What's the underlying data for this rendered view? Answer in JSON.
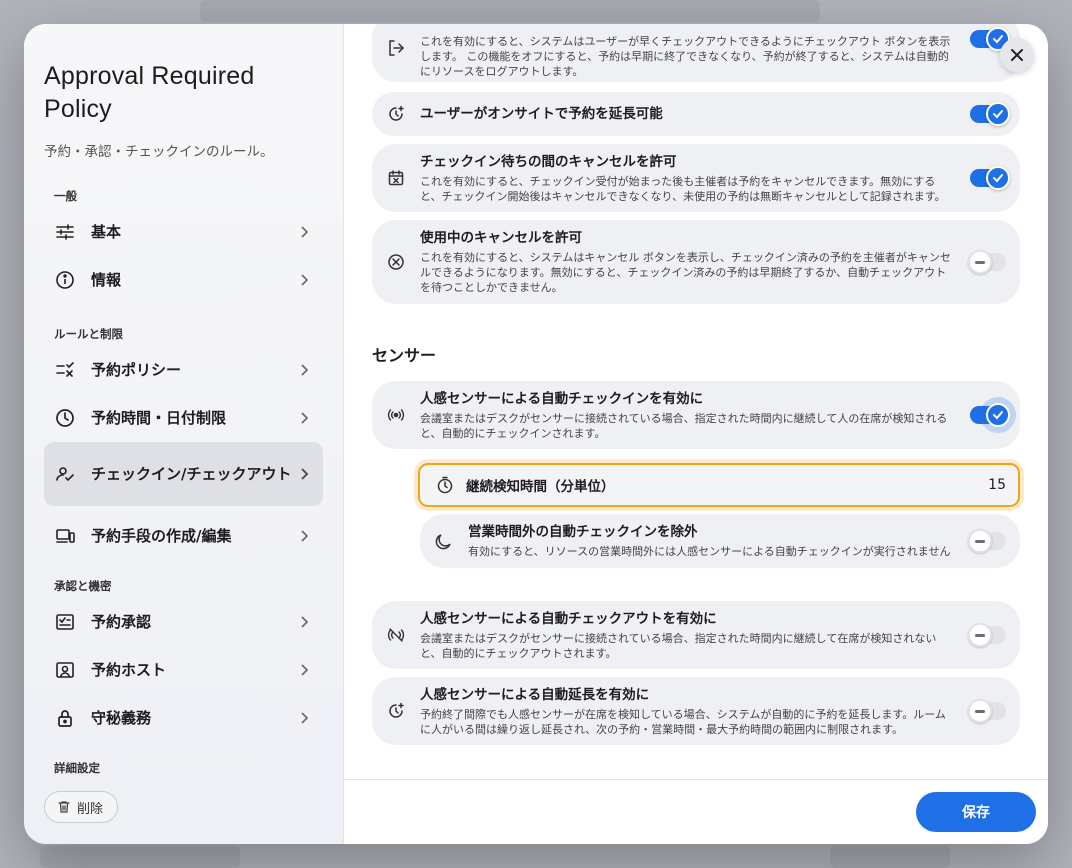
{
  "sidebar": {
    "title": "Approval Required Policy",
    "subtitle": "予約・承認・チェックインのルール。",
    "groups": [
      {
        "label": "一般"
      },
      {
        "label": "ルールと制限"
      },
      {
        "label": "承認と機密"
      },
      {
        "label": "詳細設定"
      }
    ],
    "items": [
      {
        "label": "基本",
        "icon": "sliders-icon"
      },
      {
        "label": "情報",
        "icon": "info-icon"
      },
      {
        "label": "予約ポリシー",
        "icon": "checklist-icon"
      },
      {
        "label": "予約時間・日付制限",
        "icon": "clock-icon"
      },
      {
        "label": "チェックイン/チェックアウト",
        "icon": "user-check-icon",
        "active": true
      },
      {
        "label": "予約手段の作成/編集",
        "icon": "devices-icon"
      },
      {
        "label": "予約承認",
        "icon": "approval-icon"
      },
      {
        "label": "予約ホスト",
        "icon": "host-icon"
      },
      {
        "label": "守秘義務",
        "icon": "lock-icon"
      }
    ],
    "delete_label": "削除"
  },
  "settings": [
    {
      "title": "",
      "desc": "これを有効にすると、システムはユーザーが早くチェックアウトできるようにチェックアウト ボタンを表示します。 この機能をオフにすると、予約は早期に終了できなくなり、予約が終了すると、システムは自動的にリソースをログアウトします。",
      "on": true,
      "icon": "logout-icon"
    },
    {
      "title": "ユーザーがオンサイトで予約を延長可能",
      "desc": "",
      "on": true,
      "icon": "extend-icon"
    },
    {
      "title": "チェックイン待ちの間のキャンセルを許可",
      "desc": "これを有効にすると、チェックイン受付が始まった後も主催者は予約をキャンセルできます。無効にすると、チェックイン開始後はキャンセルできなくなり、未使用の予約は無断キャンセルとして記録されます。",
      "on": true,
      "icon": "calendar-x-icon"
    },
    {
      "title": "使用中のキャンセルを許可",
      "desc": "これを有効にすると、システムはキャンセル ボタンを表示し、チェックイン済みの予約を主催者がキャンセルできるようになります。無効にすると、チェックイン済みの予約は早期終了するか、自動チェックアウトを待つことしかできません。",
      "on": false,
      "icon": "circle-x-icon"
    }
  ],
  "sensor": {
    "section_title": "センサー",
    "auto_checkin": {
      "title": "人感センサーによる自動チェックインを有効に",
      "desc": "会議室またはデスクがセンサーに接続されている場合、指定された時間内に継続して人の在席が検知されると、自動的にチェックインされます。",
      "on": true
    },
    "duration": {
      "label": "継続検知時間（分単位）",
      "value": "15"
    },
    "exclude_hours": {
      "title": "営業時間外の自動チェックインを除外",
      "desc": "有効にすると、リソースの営業時間外には人感センサーによる自動チェックインが実行されません",
      "on": false
    },
    "auto_checkout": {
      "title": "人感センサーによる自動チェックアウトを有効に",
      "desc": "会議室またはデスクがセンサーに接続されている場合、指定された時間内に継続して在席が検知されないと、自動的にチェックアウトされます。",
      "on": false
    },
    "auto_extend": {
      "title": "人感センサーによる自動延長を有効に",
      "desc": "予約終了間際でも人感センサーが在席を検知している場合、システムが自動的に予約を延長します。ルームに人がいる間は繰り返し延長され、次の予約・営業時間・最大予約時間の範囲内に制限されます。",
      "on": false
    }
  },
  "footer": {
    "save_label": "保存"
  },
  "colors": {
    "accent": "#1f6fe6",
    "focus": "#f0a51c"
  }
}
